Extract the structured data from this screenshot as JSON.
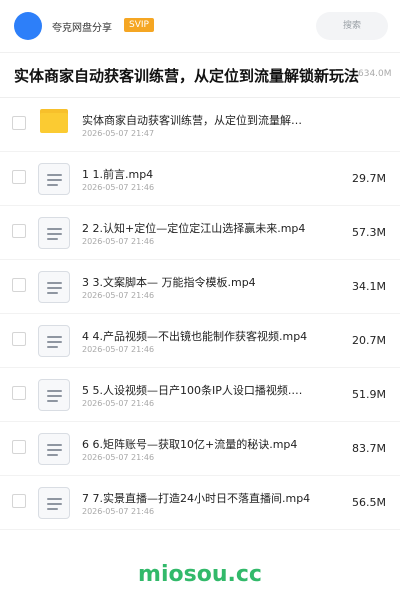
{
  "header": {
    "brand": "夸克网盘分享",
    "badge": "SVIP",
    "search_placeholder": "搜索"
  },
  "folder": {
    "title": "实体商家自动获客训练营，从定位到流量解锁新玩法",
    "size": "634.0M"
  },
  "files": [
    {
      "name": "实体商家自动获客训练营，从定位到流量解锁新玩法",
      "date": "2026-05-07 21:47",
      "size": "",
      "icon": "folder-icon"
    },
    {
      "name": "1 1.前言.mp4",
      "date": "2026-05-07 21:46",
      "size": "29.7M",
      "icon": "document-icon"
    },
    {
      "name": "2 2.认知+定位—定位定江山选择赢未来.mp4",
      "date": "2026-05-07 21:46",
      "size": "57.3M",
      "icon": "document-icon"
    },
    {
      "name": "3 3.文案脚本— 万能指令模板.mp4",
      "date": "2026-05-07 21:46",
      "size": "34.1M",
      "icon": "document-icon"
    },
    {
      "name": "4 4.产品视频—不出镜也能制作获客视频.mp4",
      "date": "2026-05-07 21:46",
      "size": "20.7M",
      "icon": "document-icon"
    },
    {
      "name": "5 5.人设视频—日产100条IP人设口播视频.m…",
      "date": "2026-05-07 21:46",
      "size": "51.9M",
      "icon": "document-icon"
    },
    {
      "name": "6 6.矩阵账号—获取10亿+流量的秘诀.mp4",
      "date": "2026-05-07 21:46",
      "size": "83.7M",
      "icon": "document-icon"
    },
    {
      "name": "7 7.实景直播—打造24小时日不落直播间.mp4",
      "date": "2026-05-07 21:46",
      "size": "56.5M",
      "icon": "document-icon"
    }
  ],
  "watermark": "miosou.cc"
}
